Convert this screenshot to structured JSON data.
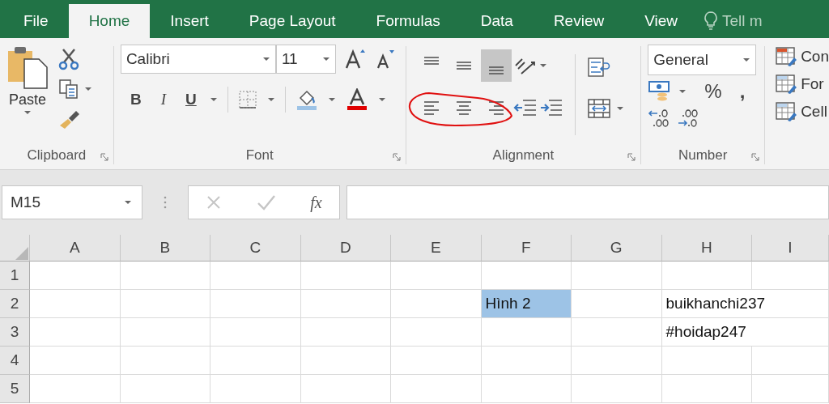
{
  "tabs": [
    {
      "label": "File",
      "selected": false
    },
    {
      "label": "Home",
      "selected": true
    },
    {
      "label": "Insert",
      "selected": false
    },
    {
      "label": "Page Layout",
      "selected": false
    },
    {
      "label": "Formulas",
      "selected": false
    },
    {
      "label": "Data",
      "selected": false
    },
    {
      "label": "Review",
      "selected": false
    },
    {
      "label": "View",
      "selected": false
    }
  ],
  "tell_me": "Tell m",
  "ribbon": {
    "clipboard": {
      "paste_label": "Paste",
      "group_label": "Clipboard"
    },
    "font": {
      "font_name": "Calibri",
      "font_size": "11",
      "bold_label": "B",
      "italic_label": "I",
      "underline_label": "U",
      "group_label": "Font"
    },
    "alignment": {
      "vertical": [
        {
          "kind": "top",
          "selected": false
        },
        {
          "kind": "middle",
          "selected": false
        },
        {
          "kind": "bottom",
          "selected": true
        }
      ],
      "horizontal": [
        {
          "kind": "left",
          "selected": false
        },
        {
          "kind": "center",
          "selected": false
        },
        {
          "kind": "right",
          "selected": false
        }
      ],
      "group_label": "Alignment"
    },
    "number": {
      "format": "General",
      "percent_label": "%",
      "comma_label": ",",
      "group_label": "Number"
    },
    "styles": {
      "items": [
        "Con",
        "For",
        "Cell"
      ]
    }
  },
  "formula_bar": {
    "name_box": "M15",
    "function_label": "fx"
  },
  "sheet": {
    "columns": [
      "A",
      "B",
      "C",
      "D",
      "E",
      "F",
      "G",
      "H",
      "I"
    ],
    "rows": [
      {
        "header": "1",
        "cells": [
          {
            "highlighted": false
          },
          {
            "highlighted": false
          },
          {
            "highlighted": false
          },
          {
            "highlighted": false
          },
          {
            "highlighted": false
          },
          {
            "highlighted": false
          },
          {
            "highlighted": false
          },
          {
            "highlighted": false
          },
          {
            "highlighted": false
          }
        ]
      },
      {
        "header": "2",
        "cells": [
          {
            "highlighted": false
          },
          {
            "highlighted": false
          },
          {
            "highlighted": false
          },
          {
            "highlighted": false
          },
          {
            "highlighted": false
          },
          {
            "text": "Hình 2",
            "highlighted": true
          },
          {
            "highlighted": false
          },
          {
            "text": "buikhanchi237",
            "highlighted": false
          },
          {
            "highlighted": false
          }
        ]
      },
      {
        "header": "3",
        "cells": [
          {
            "highlighted": false
          },
          {
            "highlighted": false
          },
          {
            "highlighted": false
          },
          {
            "highlighted": false
          },
          {
            "highlighted": false
          },
          {
            "highlighted": false
          },
          {
            "highlighted": false
          },
          {
            "text": "#hoidap247",
            "highlighted": false
          },
          {
            "highlighted": false
          }
        ]
      },
      {
        "header": "4",
        "cells": [
          {
            "highlighted": false
          },
          {
            "highlighted": false
          },
          {
            "highlighted": false
          },
          {
            "highlighted": false
          },
          {
            "highlighted": false
          },
          {
            "highlighted": false
          },
          {
            "highlighted": false
          },
          {
            "highlighted": false
          },
          {
            "highlighted": false
          }
        ]
      },
      {
        "header": "5",
        "cells": [
          {
            "highlighted": false
          },
          {
            "highlighted": false
          },
          {
            "highlighted": false
          },
          {
            "highlighted": false
          },
          {
            "highlighted": false
          },
          {
            "highlighted": false
          },
          {
            "highlighted": false
          },
          {
            "highlighted": false
          },
          {
            "highlighted": false
          }
        ]
      }
    ]
  }
}
